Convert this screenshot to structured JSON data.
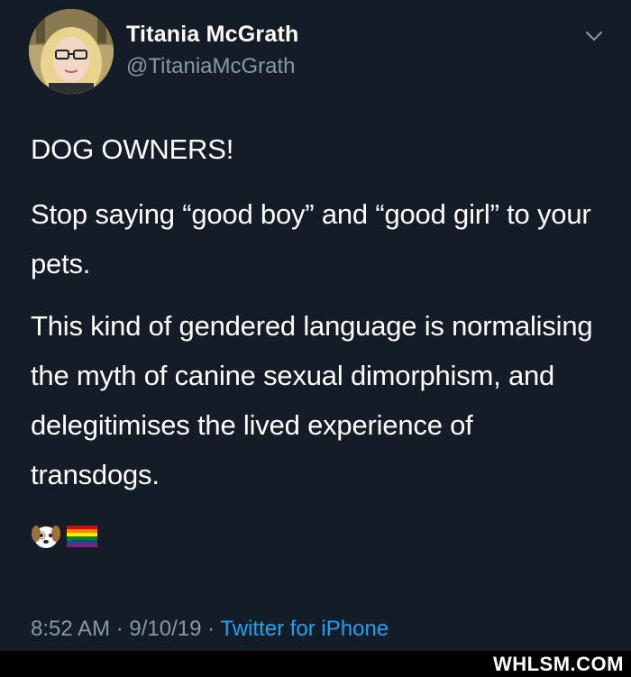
{
  "author": {
    "name": "Titania McGrath",
    "handle": "@TitaniaMcGrath"
  },
  "tweet": {
    "paragraphs": [
      "DOG OWNERS!",
      "Stop saying “good boy” and “good girl” to your pets.",
      "This kind of gendered language is normalising the myth of canine sexual dimorphism, and delegitimises the lived experience of transdogs."
    ],
    "emojis": [
      "dog-face-emoji",
      "rainbow-flag-emoji"
    ]
  },
  "meta": {
    "time": "8:52 AM",
    "separator": "·",
    "date": "9/10/19",
    "source": "Twitter for iPhone"
  },
  "watermark": "WHLSM.COM",
  "colors": {
    "background": "#141d27",
    "text": "#ffffff",
    "secondary": "#8899a6",
    "link": "#1da1f2"
  },
  "icons": [
    "avatar",
    "chevron-down-icon"
  ]
}
